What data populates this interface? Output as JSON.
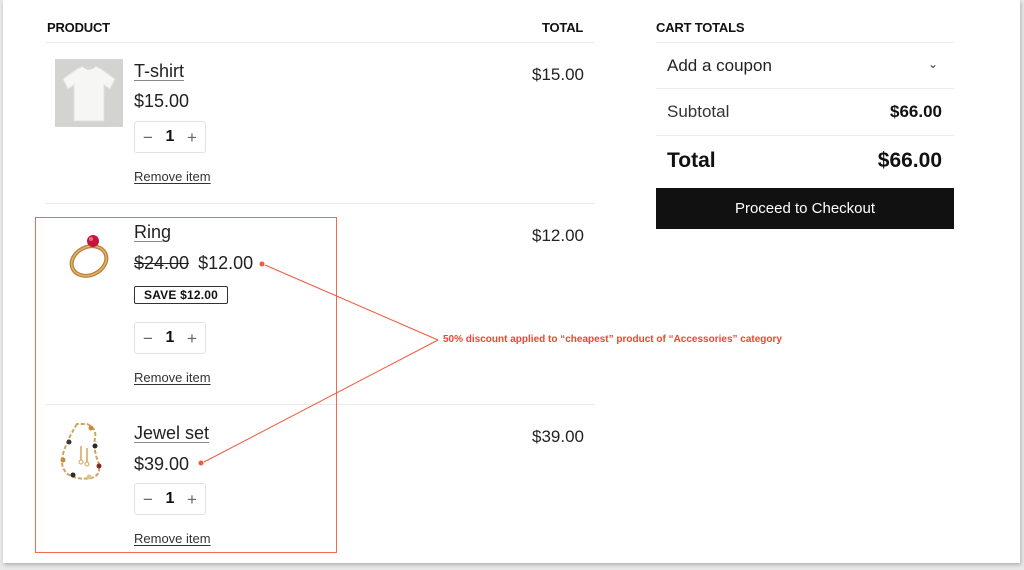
{
  "cart": {
    "headers": {
      "product": "PRODUCT",
      "total": "TOTAL"
    },
    "items": [
      {
        "name": "T-shirt",
        "image_icon": "tshirt-image",
        "price": "$15.00",
        "quantity": "1",
        "remove_label": "Remove item",
        "line_total": "$15.00"
      },
      {
        "name": "Ring",
        "image_icon": "ring-image",
        "original_price": "$24.00",
        "price": "$12.00",
        "save_badge": "SAVE $12.00",
        "quantity": "1",
        "remove_label": "Remove item",
        "line_total": "$12.00"
      },
      {
        "name": "Jewel set",
        "image_icon": "jewel-set-image",
        "price": "$39.00",
        "quantity": "1",
        "remove_label": "Remove item",
        "line_total": "$39.00"
      }
    ],
    "qty_minus": "−",
    "qty_plus": "+"
  },
  "totals": {
    "header": "CART TOTALS",
    "coupon_label": "Add a coupon",
    "coupon_chevron": "⌄",
    "subtotal_label": "Subtotal",
    "subtotal_value": "$66.00",
    "total_label": "Total",
    "total_value": "$66.00",
    "checkout_label": "Proceed to Checkout"
  },
  "annotation": {
    "text": "50% discount applied to “cheapest” product of “Accessories” category",
    "color": "#f0462c"
  }
}
